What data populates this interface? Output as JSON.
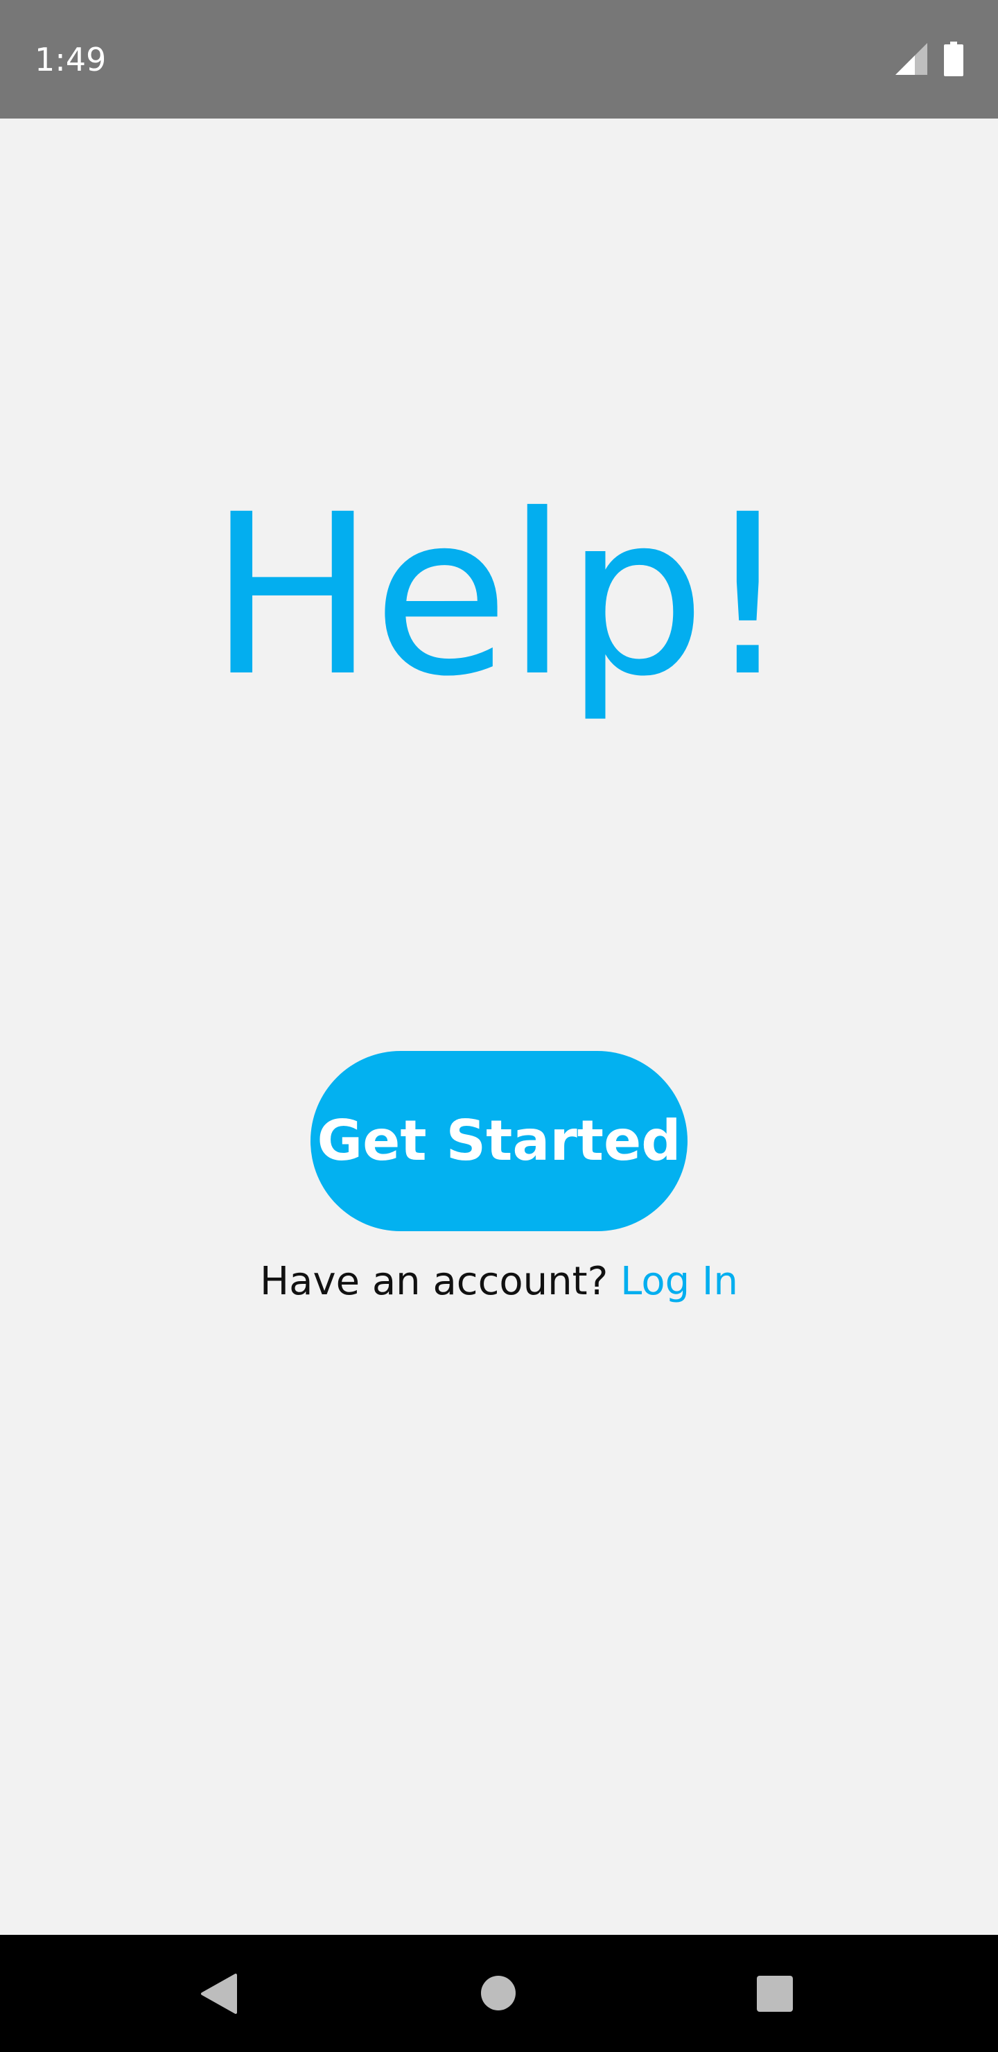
{
  "status_bar": {
    "time": "1:49",
    "icons": [
      "signal-icon",
      "battery-icon"
    ]
  },
  "main": {
    "title": "Help!",
    "get_started_label": "Get Started",
    "login_prompt": "Have an account?",
    "login_link": "Log In"
  },
  "nav_bar": {
    "icons": [
      "back-icon",
      "home-icon",
      "recents-icon"
    ]
  },
  "colors": {
    "accent": "#03aeef",
    "background": "#f2f2f2",
    "status_bar": "#777777",
    "nav_bar": "#000000"
  }
}
